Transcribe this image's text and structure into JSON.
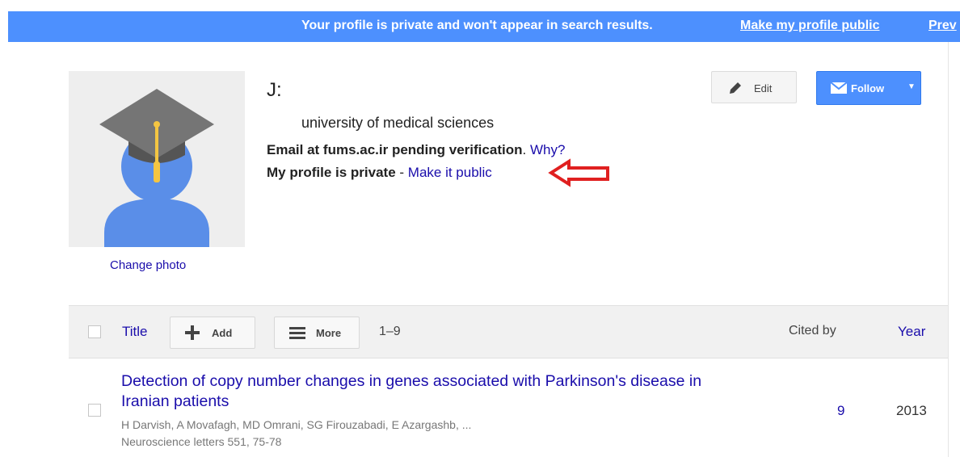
{
  "banner": {
    "message": "Your profile is private and won't appear in search results.",
    "make_public_link": "Make my profile public",
    "preview_link": "Prev"
  },
  "profile": {
    "change_photo": "Change photo",
    "name": "J:",
    "affiliation": "university of medical sciences",
    "email_text": "Email at fums.ac.ir pending verification",
    "email_sep": ".",
    "why_link": "Why?",
    "privacy_text": "My profile is private",
    "privacy_sep": " - ",
    "make_public_link": "Make it public"
  },
  "actions": {
    "edit_label": "Edit",
    "follow_label": "Follow"
  },
  "table": {
    "title_header": "Title",
    "add_label": "Add",
    "more_label": "More",
    "range": "1–9",
    "cited_by_header": "Cited by",
    "year_header": "Year",
    "rows": [
      {
        "title": "Detection of copy number changes in genes associated with Parkinson's disease in Iranian patients",
        "authors": "H Darvish, A Movafagh, MD Omrani, SG Firouzabadi, E Azargashb, ...",
        "venue": "Neuroscience letters 551, 75-78",
        "cited_by": "9",
        "year": "2013"
      }
    ]
  },
  "colors": {
    "banner_blue": "#4d90fe",
    "link_blue": "#1a0dab",
    "annotation_red": "#e02020"
  }
}
